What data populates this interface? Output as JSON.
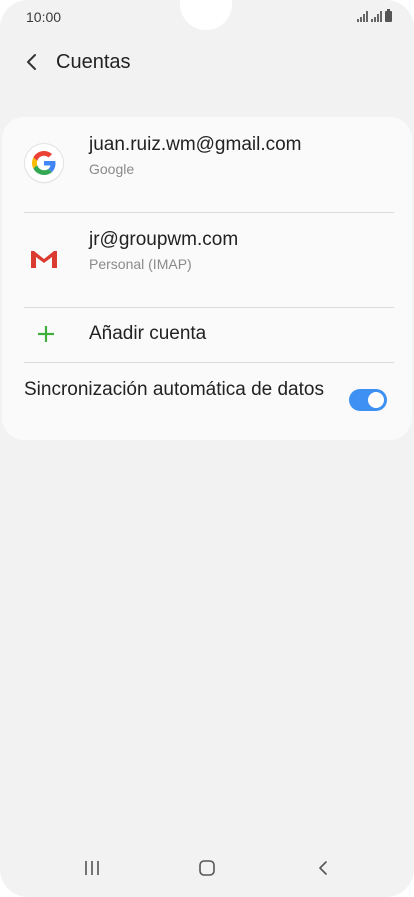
{
  "status_bar": {
    "time": "10:00"
  },
  "header": {
    "back_icon": "chevron-left-icon",
    "title": "Cuentas"
  },
  "accounts": [
    {
      "email": "juan.ruiz.wm@gmail.com",
      "type": "Google",
      "icon": "google-logo-icon"
    },
    {
      "email": "jr@groupwm.com",
      "type": "Personal (IMAP)",
      "icon": "gmail-logo-icon"
    }
  ],
  "add_account": {
    "label": "Añadir cuenta",
    "icon": "plus-icon",
    "icon_color": "#3fae3a"
  },
  "sync": {
    "label": "Sincronización automática de datos",
    "enabled": true,
    "toggle_color": "#3e91f2"
  },
  "nav_bar": {
    "recents_icon": "recents-icon",
    "home_icon": "home-icon",
    "back_icon": "back-icon"
  }
}
